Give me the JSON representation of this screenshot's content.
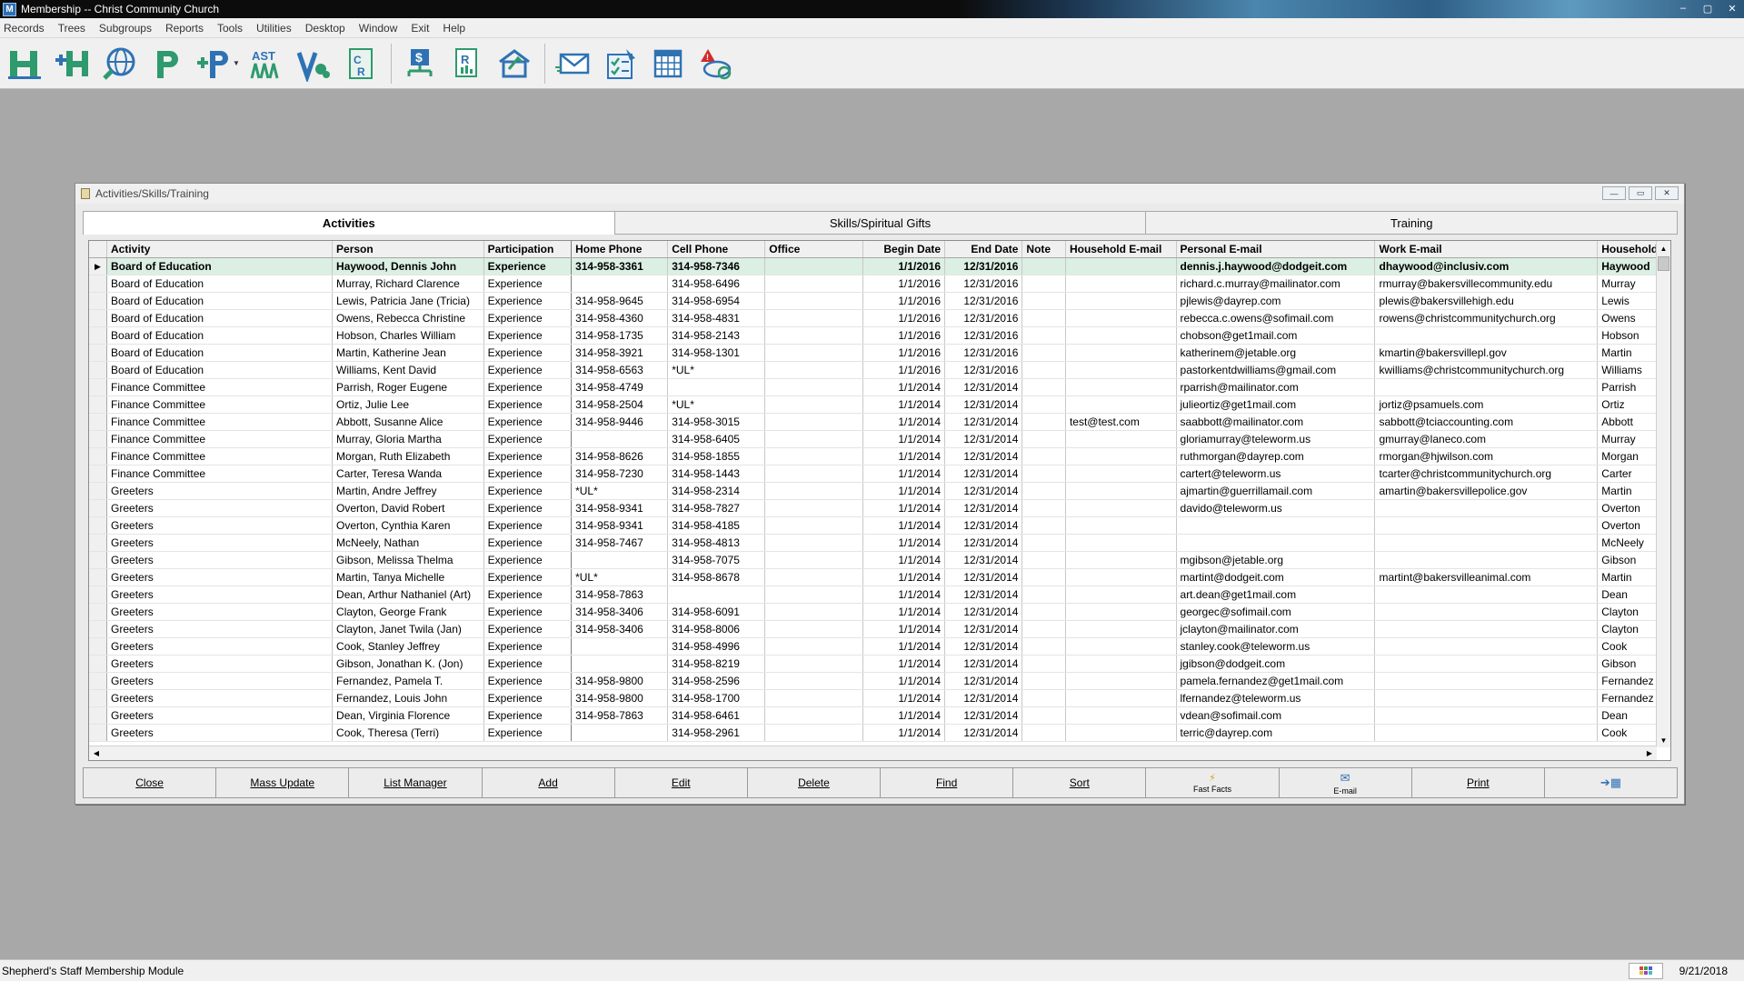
{
  "window": {
    "app_icon": "M",
    "title": "Membership -- Christ Community Church",
    "controls": [
      "–",
      "▢",
      "✕"
    ]
  },
  "menu": [
    "Records",
    "Trees",
    "Subgroups",
    "Reports",
    "Tools",
    "Utilities",
    "Desktop",
    "Window",
    "Exit",
    "Help"
  ],
  "toolbar": {
    "icons": [
      {
        "name": "household-icon",
        "label": "H"
      },
      {
        "name": "add-household-icon",
        "label": "+H"
      },
      {
        "name": "globe-search-icon",
        "label": ""
      },
      {
        "name": "person-icon",
        "label": "P"
      },
      {
        "name": "add-person-icon",
        "label": "+P"
      },
      {
        "name": "attendance-icon",
        "label": "AST"
      },
      {
        "name": "visitor-icon",
        "label": "V"
      },
      {
        "name": "contribution-record-icon",
        "label": "CR"
      },
      {
        "name": "stewardship-icon",
        "label": "$"
      },
      {
        "name": "reports-icon",
        "label": "R"
      },
      {
        "name": "mail-house-icon",
        "label": ""
      },
      {
        "name": "email-icon",
        "label": ""
      },
      {
        "name": "checklist-icon",
        "label": ""
      },
      {
        "name": "calendar-icon",
        "label": ""
      },
      {
        "name": "alert-sync-icon",
        "label": "!"
      }
    ],
    "colors": {
      "green": "#2e9a6e",
      "blue": "#2f72b4"
    }
  },
  "child_window": {
    "title": "Activities/Skills/Training",
    "controls": [
      "—",
      "▭",
      "✕"
    ]
  },
  "tabs": [
    {
      "label": "Activities",
      "active": true
    },
    {
      "label": "Skills/Spiritual Gifts",
      "active": false
    },
    {
      "label": "Training",
      "active": false
    }
  ],
  "grid": {
    "columns": [
      "Activity",
      "Person",
      "Participation",
      "Home Phone",
      "Cell Phone",
      "Office",
      "Begin Date",
      "End Date",
      "Note",
      "Household E-mail",
      "Personal E-mail",
      "Work E-mail",
      "Household"
    ],
    "rows": [
      [
        "Board of Education",
        "Haywood, Dennis John",
        "Experience",
        "314-958-3361",
        "314-958-7346",
        "",
        "1/1/2016",
        "12/31/2016",
        "",
        "",
        "dennis.j.haywood@dodgeit.com",
        "dhaywood@inclusiv.com",
        "Haywood"
      ],
      [
        "Board of Education",
        "Murray, Richard Clarence",
        "Experience",
        "",
        "314-958-6496",
        "",
        "1/1/2016",
        "12/31/2016",
        "",
        "",
        "richard.c.murray@mailinator.com",
        "rmurray@bakersvillecommunity.edu",
        "Murray"
      ],
      [
        "Board of Education",
        "Lewis, Patricia Jane (Tricia)",
        "Experience",
        "314-958-9645",
        "314-958-6954",
        "",
        "1/1/2016",
        "12/31/2016",
        "",
        "",
        "pjlewis@dayrep.com",
        "plewis@bakersvillehigh.edu",
        "Lewis"
      ],
      [
        "Board of Education",
        "Owens, Rebecca Christine",
        "Experience",
        "314-958-4360",
        "314-958-4831",
        "",
        "1/1/2016",
        "12/31/2016",
        "",
        "",
        "rebecca.c.owens@sofimail.com",
        "rowens@christcommunitychurch.org",
        "Owens"
      ],
      [
        "Board of Education",
        "Hobson, Charles William",
        "Experience",
        "314-958-1735",
        "314-958-2143",
        "",
        "1/1/2016",
        "12/31/2016",
        "",
        "",
        "chobson@get1mail.com",
        "",
        "Hobson"
      ],
      [
        "Board of Education",
        "Martin, Katherine Jean",
        "Experience",
        "314-958-3921",
        "314-958-1301",
        "",
        "1/1/2016",
        "12/31/2016",
        "",
        "",
        "katherinem@jetable.org",
        "kmartin@bakersvillepl.gov",
        "Martin"
      ],
      [
        "Board of Education",
        "Williams, Kent David",
        "Experience",
        "314-958-6563",
        "*UL*",
        "",
        "1/1/2016",
        "12/31/2016",
        "",
        "",
        "pastorkentdwilliams@gmail.com",
        "kwilliams@christcommunitychurch.org",
        "Williams"
      ],
      [
        "Finance Committee",
        "Parrish, Roger Eugene",
        "Experience",
        "314-958-4749",
        "",
        "",
        "1/1/2014",
        "12/31/2014",
        "",
        "",
        "rparrish@mailinator.com",
        "",
        "Parrish"
      ],
      [
        "Finance Committee",
        "Ortiz, Julie Lee",
        "Experience",
        "314-958-2504",
        "*UL*",
        "",
        "1/1/2014",
        "12/31/2014",
        "",
        "",
        "julieortiz@get1mail.com",
        "jortiz@psamuels.com",
        "Ortiz"
      ],
      [
        "Finance Committee",
        "Abbott, Susanne Alice",
        "Experience",
        "314-958-9446",
        "314-958-3015",
        "",
        "1/1/2014",
        "12/31/2014",
        "",
        "test@test.com",
        "saabbott@mailinator.com",
        "sabbott@tciaccounting.com",
        "Abbott"
      ],
      [
        "Finance Committee",
        "Murray, Gloria Martha",
        "Experience",
        "",
        "314-958-6405",
        "",
        "1/1/2014",
        "12/31/2014",
        "",
        "",
        "gloriamurray@teleworm.us",
        "gmurray@laneco.com",
        "Murray"
      ],
      [
        "Finance Committee",
        "Morgan, Ruth Elizabeth",
        "Experience",
        "314-958-8626",
        "314-958-1855",
        "",
        "1/1/2014",
        "12/31/2014",
        "",
        "",
        "ruthmorgan@dayrep.com",
        "rmorgan@hjwilson.com",
        "Morgan"
      ],
      [
        "Finance Committee",
        "Carter, Teresa Wanda",
        "Experience",
        "314-958-7230",
        "314-958-1443",
        "",
        "1/1/2014",
        "12/31/2014",
        "",
        "",
        "cartert@teleworm.us",
        "tcarter@christcommunitychurch.org",
        "Carter"
      ],
      [
        "Greeters",
        "Martin, Andre Jeffrey",
        "Experience",
        "*UL*",
        "314-958-2314",
        "",
        "1/1/2014",
        "12/31/2014",
        "",
        "",
        "ajmartin@guerrillamail.com",
        "amartin@bakersvillepolice.gov",
        "Martin"
      ],
      [
        "Greeters",
        "Overton, David Robert",
        "Experience",
        "314-958-9341",
        "314-958-7827",
        "",
        "1/1/2014",
        "12/31/2014",
        "",
        "",
        "davido@teleworm.us",
        "",
        "Overton"
      ],
      [
        "Greeters",
        "Overton, Cynthia Karen",
        "Experience",
        "314-958-9341",
        "314-958-4185",
        "",
        "1/1/2014",
        "12/31/2014",
        "",
        "",
        "",
        "",
        "Overton"
      ],
      [
        "Greeters",
        "McNeely, Nathan",
        "Experience",
        "314-958-7467",
        "314-958-4813",
        "",
        "1/1/2014",
        "12/31/2014",
        "",
        "",
        "",
        "",
        "McNeely"
      ],
      [
        "Greeters",
        "Gibson, Melissa Thelma",
        "Experience",
        "",
        "314-958-7075",
        "",
        "1/1/2014",
        "12/31/2014",
        "",
        "",
        "mgibson@jetable.org",
        "",
        "Gibson"
      ],
      [
        "Greeters",
        "Martin, Tanya Michelle",
        "Experience",
        "*UL*",
        "314-958-8678",
        "",
        "1/1/2014",
        "12/31/2014",
        "",
        "",
        "martint@dodgeit.com",
        "martint@bakersvilleanimal.com",
        "Martin"
      ],
      [
        "Greeters",
        "Dean, Arthur Nathaniel (Art)",
        "Experience",
        "314-958-7863",
        "",
        "",
        "1/1/2014",
        "12/31/2014",
        "",
        "",
        "art.dean@get1mail.com",
        "",
        "Dean"
      ],
      [
        "Greeters",
        "Clayton, George Frank",
        "Experience",
        "314-958-3406",
        "314-958-6091",
        "",
        "1/1/2014",
        "12/31/2014",
        "",
        "",
        "georgec@sofimail.com",
        "",
        "Clayton"
      ],
      [
        "Greeters",
        "Clayton, Janet Twila (Jan)",
        "Experience",
        "314-958-3406",
        "314-958-8006",
        "",
        "1/1/2014",
        "12/31/2014",
        "",
        "",
        "jclayton@mailinator.com",
        "",
        "Clayton"
      ],
      [
        "Greeters",
        "Cook, Stanley Jeffrey",
        "Experience",
        "",
        "314-958-4996",
        "",
        "1/1/2014",
        "12/31/2014",
        "",
        "",
        "stanley.cook@teleworm.us",
        "",
        "Cook"
      ],
      [
        "Greeters",
        "Gibson, Jonathan K. (Jon)",
        "Experience",
        "",
        "314-958-8219",
        "",
        "1/1/2014",
        "12/31/2014",
        "",
        "",
        "jgibson@dodgeit.com",
        "",
        "Gibson"
      ],
      [
        "Greeters",
        "Fernandez, Pamela T.",
        "Experience",
        "314-958-9800",
        "314-958-2596",
        "",
        "1/1/2014",
        "12/31/2014",
        "",
        "",
        "pamela.fernandez@get1mail.com",
        "",
        "Fernandez"
      ],
      [
        "Greeters",
        "Fernandez, Louis John",
        "Experience",
        "314-958-9800",
        "314-958-1700",
        "",
        "1/1/2014",
        "12/31/2014",
        "",
        "",
        "lfernandez@teleworm.us",
        "",
        "Fernandez"
      ],
      [
        "Greeters",
        "Dean, Virginia Florence",
        "Experience",
        "314-958-7863",
        "314-958-6461",
        "",
        "1/1/2014",
        "12/31/2014",
        "",
        "",
        "vdean@sofimail.com",
        "",
        "Dean"
      ],
      [
        "Greeters",
        "Cook, Theresa (Terri)",
        "Experience",
        "",
        "314-958-2961",
        "",
        "1/1/2014",
        "12/31/2014",
        "",
        "",
        "terric@dayrep.com",
        "",
        "Cook"
      ]
    ],
    "selected_row": 0,
    "row_indicator": "▶"
  },
  "buttons": [
    {
      "name": "close-button",
      "label": "Close",
      "icon": ""
    },
    {
      "name": "mass-update-button",
      "label": "Mass Update",
      "icon": ""
    },
    {
      "name": "list-manager-button",
      "label": "List Manager",
      "icon": ""
    },
    {
      "name": "add-button",
      "label": "Add",
      "icon": ""
    },
    {
      "name": "edit-button",
      "label": "Edit",
      "icon": ""
    },
    {
      "name": "delete-button",
      "label": "Delete",
      "icon": ""
    },
    {
      "name": "find-button",
      "label": "Find",
      "icon": ""
    },
    {
      "name": "sort-button",
      "label": "Sort",
      "icon": ""
    },
    {
      "name": "fast-facts-button",
      "label": "Fast Facts",
      "icon": "⚡"
    },
    {
      "name": "email-button",
      "label": "E-mail",
      "icon": "✉"
    },
    {
      "name": "print-button",
      "label": "Print",
      "icon": ""
    },
    {
      "name": "export-button",
      "label": "",
      "icon": "➔▦"
    }
  ],
  "status": {
    "module": "Shepherd's Staff Membership Module",
    "date": "9/21/2018"
  }
}
